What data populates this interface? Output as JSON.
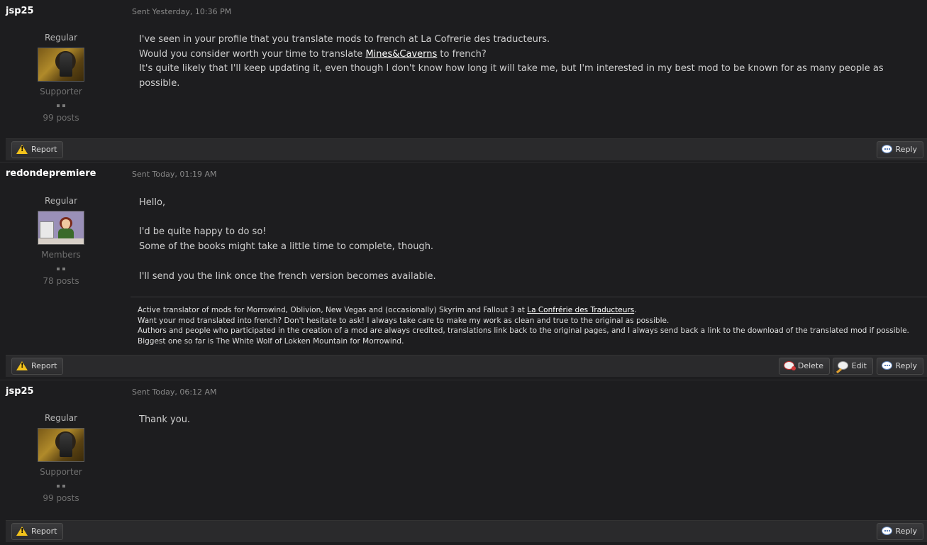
{
  "posts": [
    {
      "username": "jsp25",
      "sent": "Sent Yesterday, 10:36 PM",
      "role": "Regular",
      "group": "Supporter",
      "post_count": "99 posts",
      "avatar_icon": "knight-avatar",
      "body": {
        "line1": "I've seen in your profile that you translate mods to french at La Cofrerie des traducteurs.",
        "line2_before": "Would you consider worth your time to translate ",
        "line2_link": "Mines&Caverns",
        "line2_after": " to french?",
        "line3": "It's quite likely that I'll keep updating it, even though I don't know how long it will take me, but I'm interested in my best mod to be known for as many people as possible."
      },
      "buttons": {
        "report": "Report",
        "reply": "Reply"
      }
    },
    {
      "username": "redondepremiere",
      "sent": "Sent Today, 01:19 AM",
      "role": "Regular",
      "group": "Members",
      "post_count": "78 posts",
      "avatar_icon": "girl-at-computer-avatar",
      "body": {
        "line1": "Hello,",
        "line2": "I'd be quite happy to do so!",
        "line3": "Some of the books might take a little time to complete, though.",
        "line4": "I'll send you the link once the french version becomes available."
      },
      "signature": {
        "line1_before": "Active translator of mods for Morrowind, Oblivion, New Vegas and (occasionally) Skyrim and Fallout 3 at ",
        "line1_link": "La Confrérie des Traducteurs",
        "line1_after": ".",
        "line2": "Want your mod translated into french? Don't hesitate to ask! I always take care to make my work as clean and true to the original as possible.",
        "line3": "Authors and people who participated in the creation of a mod are always credited, translations link back to the original pages, and I always send back a link to the download of the translated mod if possible.",
        "line4": "Biggest one so far is The White Wolf of Lokken Mountain for Morrowind."
      },
      "buttons": {
        "report": "Report",
        "delete": "Delete",
        "edit": "Edit",
        "reply": "Reply"
      }
    },
    {
      "username": "jsp25",
      "sent": "Sent Today, 06:12 AM",
      "role": "Regular",
      "group": "Supporter",
      "post_count": "99 posts",
      "avatar_icon": "knight-avatar",
      "body": {
        "line1": "Thank you."
      },
      "buttons": {
        "report": "Report",
        "reply": "Reply"
      }
    }
  ],
  "colors": {
    "background": "#1d1d1f",
    "action_bar": "#2a2a2c",
    "warning_icon": "#f2c21b",
    "link": "#ffffff"
  }
}
